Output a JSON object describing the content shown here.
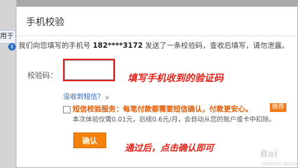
{
  "background": {
    "fragment_text": "用于"
  },
  "dialog": {
    "title": "手机校验",
    "info": {
      "prefix": "我们向您填写的手机号",
      "phone": "182****3172",
      "suffix": "发送了一条校验码，查收后填写，请勿泄露。"
    },
    "code": {
      "label": "校验码：",
      "value": "",
      "placeholder": "",
      "resend_link": "没收到短信？",
      "resend_chevron": "v"
    },
    "sms_service": {
      "checked": false,
      "title": "短信校验服务：每笔付款都需要短信确认，付款更安心。",
      "badge": "推荐",
      "description": "本次体验仅需0.01元，后续0.6元/月，会自动从您的账户或卡中扣除。"
    },
    "confirm_button": "确认"
  },
  "annotations": {
    "fill_code": "填写手机收到的验证码",
    "after_pass": "通过后，点击确认即可"
  },
  "watermark": {
    "logo": "Bai",
    "sub": "jingyan.baidu.com"
  },
  "colors": {
    "accent_orange": "#f3810c",
    "annotation_red": "#e5231b",
    "link_blue": "#2b64b8",
    "info_blue": "#2e6fc4"
  }
}
